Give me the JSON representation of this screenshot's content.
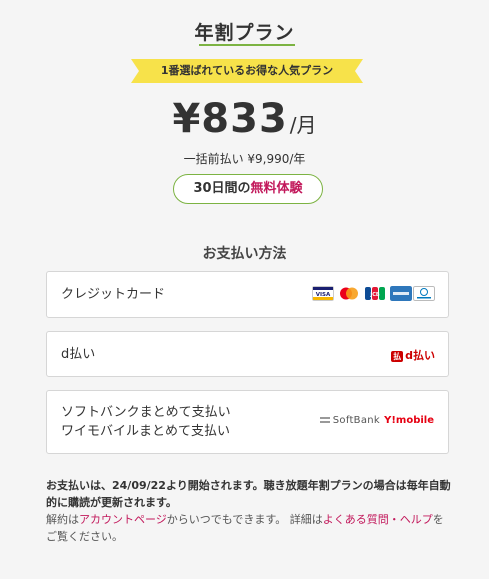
{
  "plan": {
    "title": "年割プラン",
    "ribbon": "1番選ばれているお得な人気プラン",
    "price_amount": "¥833",
    "price_unit": "/月",
    "lump_sum": "一括前払い ¥9,990/年",
    "trial_prefix": "30日間の",
    "trial_highlight": "無料体験"
  },
  "payment": {
    "heading": "お支払い方法",
    "options": [
      {
        "label": "クレジットカード",
        "icons": [
          "visa-icon",
          "mastercard-icon",
          "jcb-icon",
          "amex-icon",
          "diners-icon"
        ]
      },
      {
        "label": "d払い",
        "icons": [
          "d-barai-icon"
        ],
        "logo_text": "d払い"
      },
      {
        "label_line1": "ソフトバンクまとめて支払い",
        "label_line2": "ワイモバイルまとめて支払い",
        "logos": [
          "SoftBank",
          "Y!mobile"
        ]
      }
    ]
  },
  "notice": {
    "line1": "お支払いは、24/09/22より開始されます。聴き放題年割プランの場合は毎年自動的に購読が更新されます。",
    "cancel_prefix": "解約は",
    "account_link": "アカウントページ",
    "cancel_middle": "からいつでもできます。 詳細は",
    "faq_link": "よくある質問・ヘルプ",
    "cancel_suffix": "をご覧ください。"
  },
  "colors": {
    "accent_green": "#7cb342",
    "ribbon_yellow": "#f7e24a",
    "highlight_red": "#c2185b"
  }
}
